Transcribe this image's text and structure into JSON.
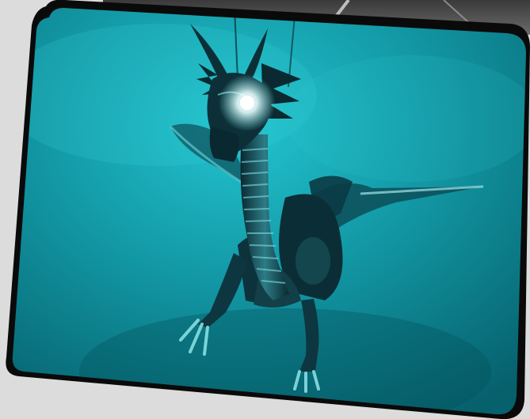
{
  "image": {
    "subject": "dragon-sculpture-underwater",
    "colors": {
      "page_background": "#dcdcdc",
      "frame": "#0a0a0a",
      "water_light": "#1fb8c4",
      "water_mid": "#0f8c99",
      "water_dark": "#06606c",
      "glow": "#ffffff",
      "metal": "#0c2b33",
      "metal_highlight": "#6fd6dc"
    }
  }
}
